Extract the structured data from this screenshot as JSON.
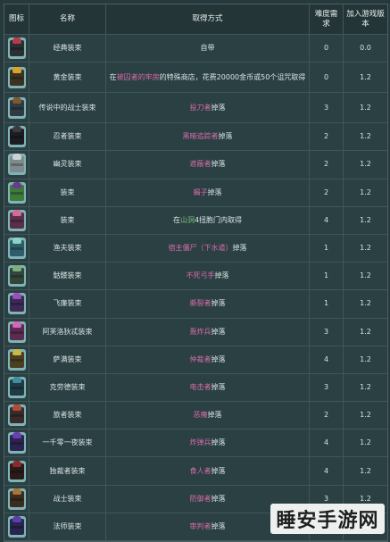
{
  "headers": {
    "icon": "图标",
    "name": "名称",
    "acquire": "取得方式",
    "difficulty": "难度需求",
    "version": "加入游戏版本"
  },
  "rows": [
    {
      "name": "经典装束",
      "acq_pre": "自带",
      "acq_hl": "",
      "acq_post": "",
      "difficulty": "0",
      "version": "0.0",
      "c1": "#b53a4a",
      "c2": "#2a2f33"
    },
    {
      "name": "黄金装束",
      "acq_pre": "在",
      "acq_hl": "被囚者的牢房",
      "acq_post": "的特殊商店，花费20000金币或50个诅咒取得",
      "difficulty": "0",
      "version": "1.2",
      "c1": "#d7a32a",
      "c2": "#3b3222"
    },
    {
      "name": "传说中的战士装束",
      "acq_pre": "",
      "acq_hl": "投刀者",
      "acq_post": "掉落",
      "difficulty": "3",
      "version": "1.2",
      "c1": "#7b5a2c",
      "c2": "#2f3a44"
    },
    {
      "name": "忍者装束",
      "acq_pre": "",
      "acq_hl": "黑暗追踪者",
      "acq_post": "掉落",
      "difficulty": "2",
      "version": "1.2",
      "c1": "#3a3a40",
      "c2": "#1c1c22"
    },
    {
      "name": "幽灵装束",
      "acq_pre": "",
      "acq_hl": "遮蔽者",
      "acq_post": "掉落",
      "difficulty": "2",
      "version": "1.2",
      "c1": "#c9d3d6",
      "c2": "#7f8a8e"
    },
    {
      "name": "装束",
      "acq_pre": "",
      "acq_hl": "蝎子",
      "acq_post": "掉落",
      "difficulty": "2",
      "version": "1.2",
      "c1": "#6b3c8c",
      "c2": "#3e7a3a"
    },
    {
      "name": "装束",
      "acq_pre": "在",
      "acq_hl": "山洞",
      "acq_post": "4扭胞门内取得",
      "difficulty": "4",
      "version": "1.2",
      "c1": "#d46c9a",
      "c2": "#5a2f4a",
      "hl_green": true
    },
    {
      "name": "渔夫装束",
      "acq_pre": "",
      "acq_hl": "宿主僵尸（下水道）",
      "acq_post": "掉落",
      "difficulty": "1",
      "version": "1.2",
      "c1": "#8bd3c7",
      "c2": "#2e5c6a"
    },
    {
      "name": "骷髅装束",
      "acq_pre": "",
      "acq_hl": "不死弓手",
      "acq_post": "掉落",
      "difficulty": "1",
      "version": "1.2",
      "c1": "#7fae7a",
      "c2": "#33453a"
    },
    {
      "name": "飞廉装束",
      "acq_pre": "",
      "acq_hl": "撕裂者",
      "acq_post": "掉落",
      "difficulty": "1",
      "version": "1.2",
      "c1": "#9a4fc0",
      "c2": "#3c2a55"
    },
    {
      "name": "阿芙洛狄忒装束",
      "acq_pre": "",
      "acq_hl": "轰炸兵",
      "acq_post": "掉落",
      "difficulty": "3",
      "version": "1.2",
      "c1": "#d06ab8",
      "c2": "#5b2b52"
    },
    {
      "name": "萨满装束",
      "acq_pre": "",
      "acq_hl": "仲裁者",
      "acq_post": "掉落",
      "difficulty": "4",
      "version": "1.2",
      "c1": "#c9b84a",
      "c2": "#4a3f20"
    },
    {
      "name": "克劳德装束",
      "acq_pre": "",
      "acq_hl": "电击者",
      "acq_post": "掉落",
      "difficulty": "3",
      "version": "1.2",
      "c1": "#3f8fa0",
      "c2": "#1f3a44"
    },
    {
      "name": "旅者装束",
      "acq_pre": "",
      "acq_hl": "恶魔",
      "acq_post": "掉落",
      "difficulty": "2",
      "version": "1.2",
      "c1": "#b04a3a",
      "c2": "#3a2a2a"
    },
    {
      "name": "一千零一夜装束",
      "acq_pre": "",
      "acq_hl": "炸弹兵",
      "acq_post": "掉落",
      "difficulty": "4",
      "version": "1.2",
      "c1": "#6a3fb0",
      "c2": "#2c2450"
    },
    {
      "name": "独裁者装束",
      "acq_pre": "",
      "acq_hl": "食人者",
      "acq_post": "掉落",
      "difficulty": "4",
      "version": "1.2",
      "c1": "#8a2a2a",
      "c2": "#2a1a1a"
    },
    {
      "name": "战士装束",
      "acq_pre": "",
      "acq_hl": "防御者",
      "acq_post": "掉落",
      "difficulty": "3",
      "version": "1.2",
      "c1": "#a8743a",
      "c2": "#3a2c1e"
    },
    {
      "name": "法师装束",
      "acq_pre": "",
      "acq_hl": "审判者",
      "acq_post": "掉落",
      "difficulty": "3",
      "version": "1.2",
      "c1": "#5a3fa8",
      "c2": "#2a2450"
    }
  ],
  "watermark": "睡安手游网",
  "colors": {
    "background": "#26393c",
    "highlight": "#d96bab",
    "highlight_alt": "#7cc67c"
  }
}
